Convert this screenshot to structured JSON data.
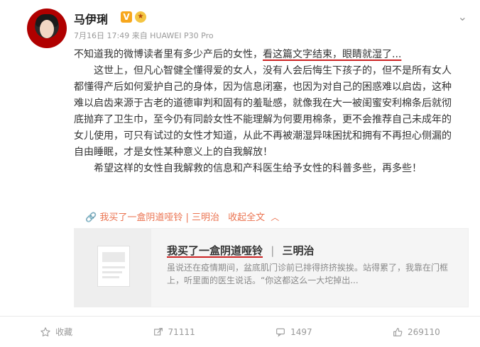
{
  "header": {
    "username": "马伊琍",
    "verified_badge": "V",
    "meta": "7月16日 17:49 来自 HUAWEI P30 Pro"
  },
  "post": {
    "line1_plain": "不知道我的微博读者里有多少产后的女性，",
    "line1_highlight": "看这篇文字结束，眼睛就湿了...",
    "para2": "这世上，但凡心智健全懂得爱的女人，没有人会后悔生下孩子的，但不是所有女人都懂得产后如何爱护自己的身体，因为信息闭塞，也因为对自己的困惑难以启齿，这种难以启齿来源于古老的道德审判和固有的羞耻感，就像我在大一被闺蜜安利棉条后就彻底抛弃了卫生巾，至今仍有同龄女性不能理解为何要用棉条，更不会推荐自己未成年的女儿使用，可只有试过的女性才知道，从此不再被潮湿异味困扰和拥有不再担心侧漏的自由睡眠，才是女性某种意义上的自我解放！",
    "para3": "希望这样的女性自我解救的信息和产科医生给予女性的科普多些，再多些！"
  },
  "link": {
    "text": "我买了一盒阴道哑铃 | 三明治",
    "collapse": "收起全文"
  },
  "card": {
    "title": "我买了一盒阴道哑铃",
    "separator": "|",
    "author": "三明治",
    "summary": "虽说还在疫情期间，盆底肌门诊前已排得挤挤挨挨。站得累了，我靠在门框上，听里面的医生说话。“你这都这么一大坨掉出..."
  },
  "actions": {
    "favorite": "收藏",
    "repost": "71111",
    "comment": "1497",
    "like": "269110"
  },
  "colors": {
    "accent": "#eb7350",
    "underline": "#cc2222",
    "muted": "#999999"
  }
}
